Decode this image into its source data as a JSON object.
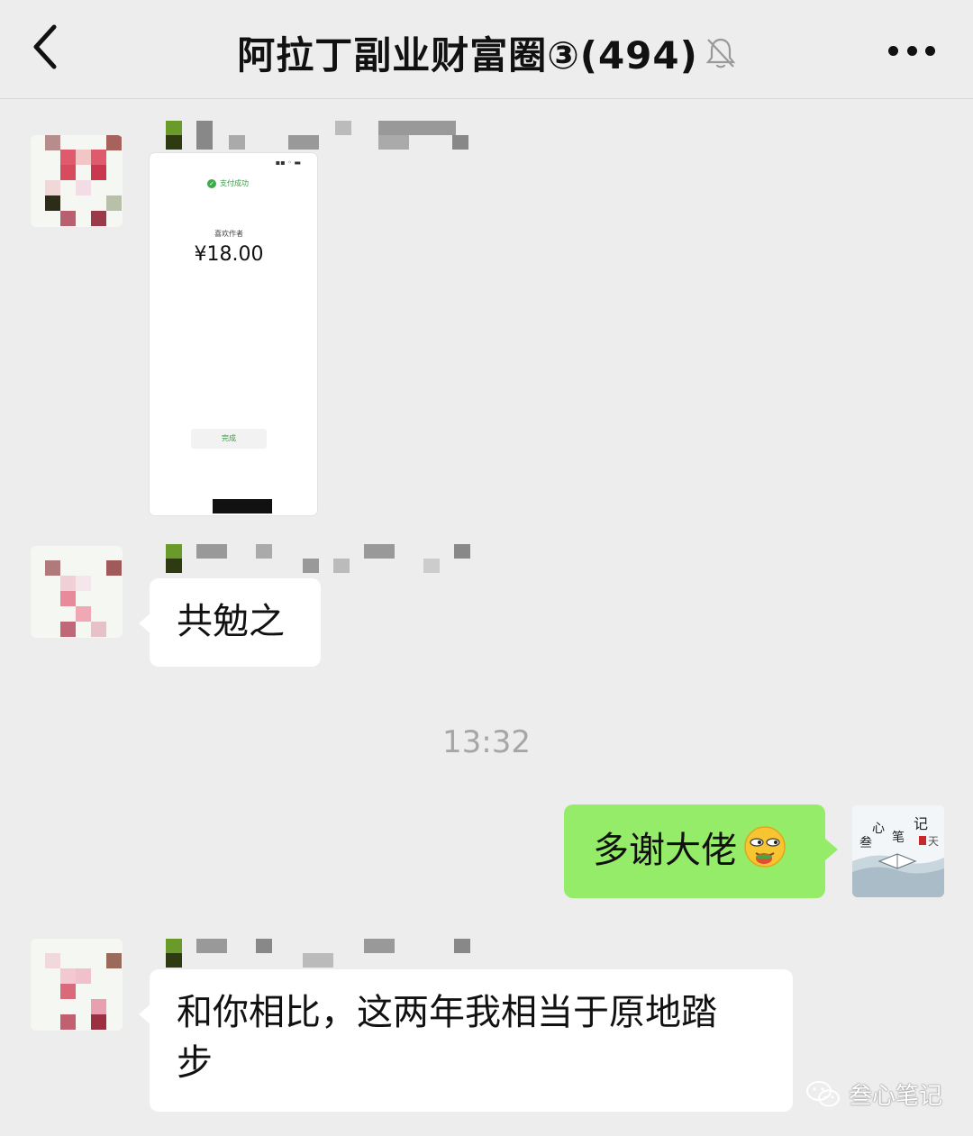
{
  "header": {
    "title": "阿拉丁副业财富圈③(494)",
    "back_icon": "chevron-left-icon",
    "mute_icon": "bell-off-icon",
    "more_icon": "more-dots-icon"
  },
  "messages": {
    "m1": {
      "sender": "left",
      "type": "image",
      "screenshot": {
        "status": "支付成功",
        "payee": "喜欢作者",
        "amount": "¥18.00",
        "done_label": "完成"
      }
    },
    "m2": {
      "sender": "left",
      "text": "共勉之"
    },
    "timestamp": "13:32",
    "m3": {
      "sender": "self",
      "text": "多谢大佬",
      "emoji": "smirk-emoji"
    },
    "m4": {
      "sender": "left",
      "text_line1": "和你相比，这两年我相当于原地踏",
      "text_line2": "步"
    }
  },
  "watermark": {
    "text": "叁心笔记",
    "icon": "wechat-icon"
  },
  "colors": {
    "background": "#ededed",
    "self_bubble": "#95ec69",
    "other_bubble": "#ffffff",
    "timestamp": "#a6a6a6"
  }
}
